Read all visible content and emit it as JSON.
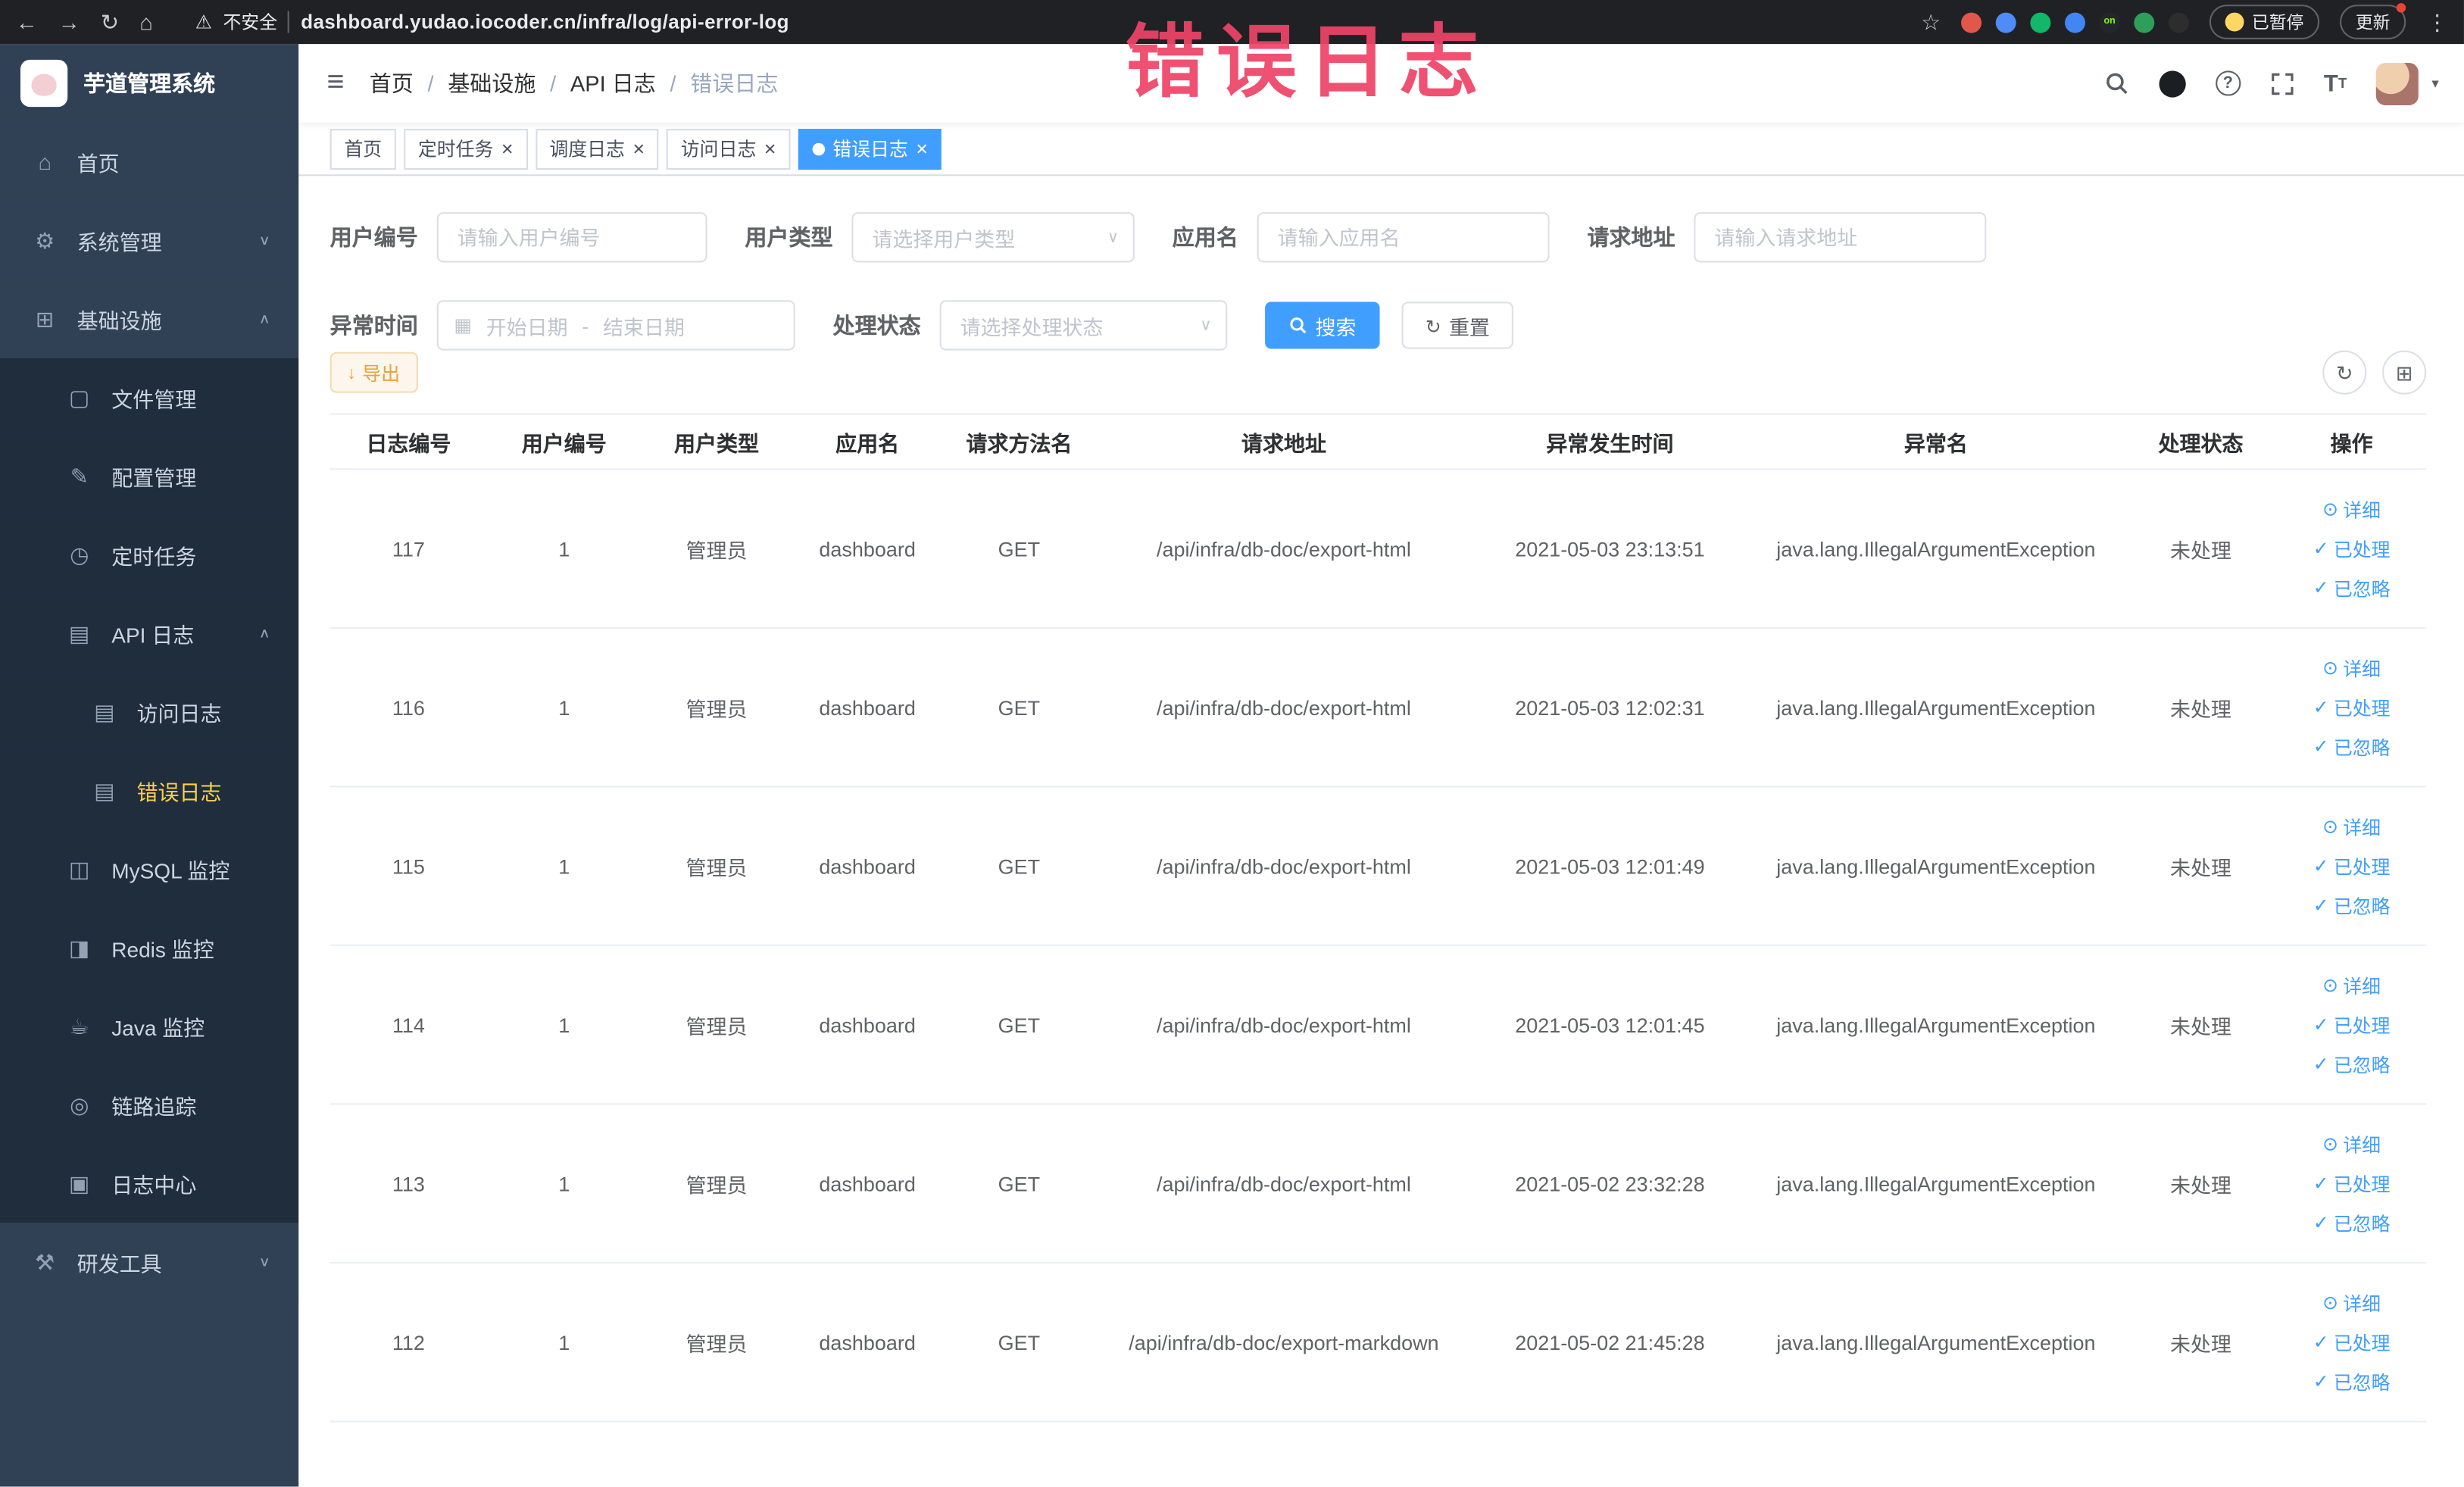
{
  "annotation": {
    "text": "错误日志",
    "color": "#ee4468"
  },
  "browser": {
    "security_label": "不安全",
    "url": "dashboard.yudao.iocoder.cn/infra/log/api-error-log",
    "paused_label": "已暂停",
    "update_label": "更新",
    "extensions": [
      {
        "name": "extension-red-icon",
        "color": "#e2574c"
      },
      {
        "name": "extension-blue-icon",
        "color": "#4e8cf9"
      },
      {
        "name": "extension-green-circle-icon",
        "color": "#12b76a"
      },
      {
        "name": "extension-grid-icon",
        "color": "#4285f4"
      },
      {
        "name": "extension-on-icon",
        "color": "#23272b",
        "badge": "on"
      },
      {
        "name": "extension-tree-icon",
        "color": "#2e9e5b"
      },
      {
        "name": "extension-paw-icon",
        "color": "#2d2d2d"
      }
    ]
  },
  "sidebar": {
    "logo_title": "芋道管理系统",
    "items": [
      {
        "label": "首页",
        "icon": "home-icon",
        "level": 1
      },
      {
        "label": "系统管理",
        "icon": "gear-icon",
        "level": 1,
        "arrow": "down"
      },
      {
        "label": "基础设施",
        "icon": "infra-icon",
        "level": 1,
        "arrow": "up"
      },
      {
        "label": "文件管理",
        "icon": "file-icon",
        "level": 2
      },
      {
        "label": "配置管理",
        "icon": "config-icon",
        "level": 2
      },
      {
        "label": "定时任务",
        "icon": "timer-icon",
        "level": 2
      },
      {
        "label": "API 日志",
        "icon": "api-log-icon",
        "level": 2,
        "arrow": "up"
      },
      {
        "label": "访问日志",
        "icon": "doc-icon",
        "level": 3
      },
      {
        "label": "错误日志",
        "icon": "doc-icon",
        "level": 3,
        "active": true
      },
      {
        "label": "MySQL 监控",
        "icon": "mysql-icon",
        "level": 2
      },
      {
        "label": "Redis 监控",
        "icon": "redis-icon",
        "level": 2
      },
      {
        "label": "Java 监控",
        "icon": "java-icon",
        "level": 2
      },
      {
        "label": "链路追踪",
        "icon": "trace-icon",
        "level": 2
      },
      {
        "label": "日志中心",
        "icon": "log-center-icon",
        "level": 2
      },
      {
        "label": "研发工具",
        "icon": "tools-icon",
        "level": 1,
        "arrow": "down"
      }
    ]
  },
  "header": {
    "breadcrumb": [
      "首页",
      "基础设施",
      "API 日志",
      "错误日志"
    ]
  },
  "tabs": [
    {
      "label": "首页"
    },
    {
      "label": "定时任务",
      "closable": true
    },
    {
      "label": "调度日志",
      "closable": true
    },
    {
      "label": "访问日志",
      "closable": true
    },
    {
      "label": "错误日志",
      "closable": true,
      "active": true
    }
  ],
  "filters": {
    "user_id_label": "用户编号",
    "user_id_placeholder": "请输入用户编号",
    "user_type_label": "用户类型",
    "user_type_placeholder": "请选择用户类型",
    "app_name_label": "应用名",
    "app_name_placeholder": "请输入应用名",
    "request_url_label": "请求地址",
    "request_url_placeholder": "请输入请求地址",
    "time_label": "异常时间",
    "time_start_placeholder": "开始日期",
    "time_separator": "-",
    "time_end_placeholder": "结束日期",
    "status_label": "处理状态",
    "status_placeholder": "请选择处理状态",
    "search_button": "搜索",
    "reset_button": "重置"
  },
  "toolbar": {
    "export_button": "导出"
  },
  "table": {
    "columns": [
      "日志编号",
      "用户编号",
      "用户类型",
      "应用名",
      "请求方法名",
      "请求地址",
      "异常发生时间",
      "异常名",
      "处理状态",
      "操作"
    ],
    "action_detail": "详细",
    "action_processed": "已处理",
    "action_ignored": "已忽略",
    "rows": [
      {
        "id": "117",
        "user_id": "1",
        "user_type": "管理员",
        "app": "dashboard",
        "method": "GET",
        "url": "/api/infra/db-doc/export-html",
        "time": "2021-05-03 23:13:51",
        "exception": "java.lang.IllegalArgumentException",
        "status": "未处理"
      },
      {
        "id": "116",
        "user_id": "1",
        "user_type": "管理员",
        "app": "dashboard",
        "method": "GET",
        "url": "/api/infra/db-doc/export-html",
        "time": "2021-05-03 12:02:31",
        "exception": "java.lang.IllegalArgumentException",
        "status": "未处理"
      },
      {
        "id": "115",
        "user_id": "1",
        "user_type": "管理员",
        "app": "dashboard",
        "method": "GET",
        "url": "/api/infra/db-doc/export-html",
        "time": "2021-05-03 12:01:49",
        "exception": "java.lang.IllegalArgumentException",
        "status": "未处理"
      },
      {
        "id": "114",
        "user_id": "1",
        "user_type": "管理员",
        "app": "dashboard",
        "method": "GET",
        "url": "/api/infra/db-doc/export-html",
        "time": "2021-05-03 12:01:45",
        "exception": "java.lang.IllegalArgumentException",
        "status": "未处理"
      },
      {
        "id": "113",
        "user_id": "1",
        "user_type": "管理员",
        "app": "dashboard",
        "method": "GET",
        "url": "/api/infra/db-doc/export-html",
        "time": "2021-05-02 23:32:28",
        "exception": "java.lang.IllegalArgumentException",
        "status": "未处理"
      },
      {
        "id": "112",
        "user_id": "1",
        "user_type": "管理员",
        "app": "dashboard",
        "method": "GET",
        "url": "/api/infra/db-doc/export-markdown",
        "time": "2021-05-02 21:45:28",
        "exception": "java.lang.IllegalArgumentException",
        "status": "未处理"
      }
    ]
  },
  "colors": {
    "accent": "#409eff",
    "sidebar_bg": "#304156",
    "submenu_bg": "#1f2d3d",
    "active_menu_text": "#ffd04b",
    "warning": "#e6a23c",
    "annotation": "#ee4468"
  }
}
